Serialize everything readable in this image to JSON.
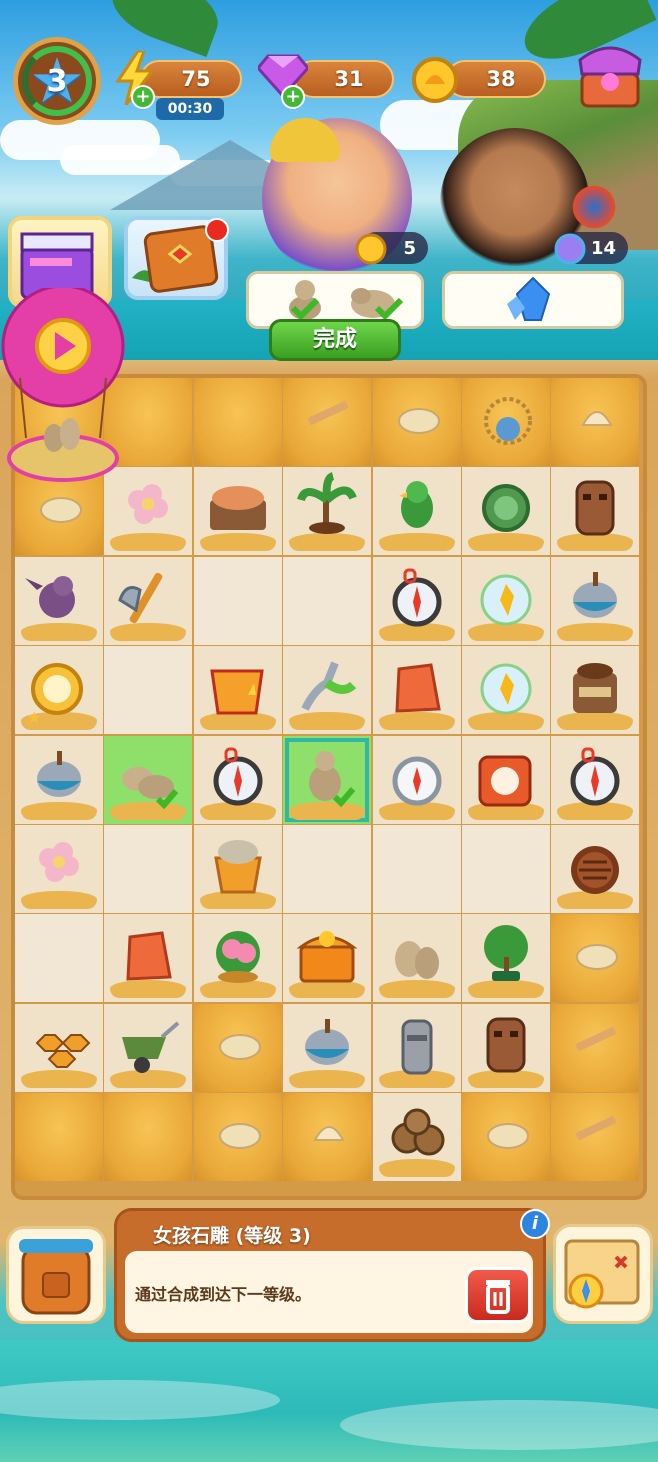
{
  "hud": {
    "level": "3",
    "energy": "75",
    "energy_timer": "00:30",
    "gems": "31",
    "coins": "38"
  },
  "orders": {
    "customer1_reward": "5",
    "customer2_reward": "14",
    "complete_label": "完成"
  },
  "board": {
    "cols": 7,
    "rows": 9,
    "cells": [
      [
        "sand",
        "sand",
        "sand",
        "sand-plank",
        "sand-rock",
        "sand-necklace",
        "sand-shell"
      ],
      [
        "sand-rock",
        "flower",
        "fish-basket",
        "palm-sapling",
        "parrot",
        "compass-green",
        "totem"
      ],
      [
        "bird",
        "axe",
        "empty",
        "empty",
        "compass",
        "gem-bubble",
        "spinning-top"
      ],
      [
        "gold-compass",
        "empty",
        "bag-orange",
        "pruner",
        "red-stone",
        "gem-bubble",
        "honey-jar"
      ],
      [
        "spinning-top",
        "statue-pair-ok",
        "compass",
        "statue-girl-ok",
        "compass-silver",
        "compass-orange",
        "compass"
      ],
      [
        "flower",
        "empty",
        "stone-basket",
        "empty",
        "empty",
        "empty",
        "chopped-wood"
      ],
      [
        "empty",
        "red-stone",
        "flower-pot",
        "treasure-chest",
        "statue-pair",
        "bonsai",
        "sand-rock"
      ],
      [
        "honeycomb",
        "wheelbarrow",
        "sand-rock",
        "spinning-top",
        "moai",
        "totem",
        "sand-plank"
      ],
      [
        "sand",
        "sand",
        "sand-rock",
        "sand-shell",
        "logs",
        "sand-rock",
        "sand-plank"
      ]
    ]
  },
  "info": {
    "title": "女孩石雕 (等级 3)",
    "description": "通过合成到达下一等级。"
  },
  "colors": {
    "sand": "#e9a838",
    "highlight": "#8fe06a",
    "complete_button": "#3a9f21",
    "info_panel": "#c66d2c",
    "trash": "#c92a1e"
  }
}
